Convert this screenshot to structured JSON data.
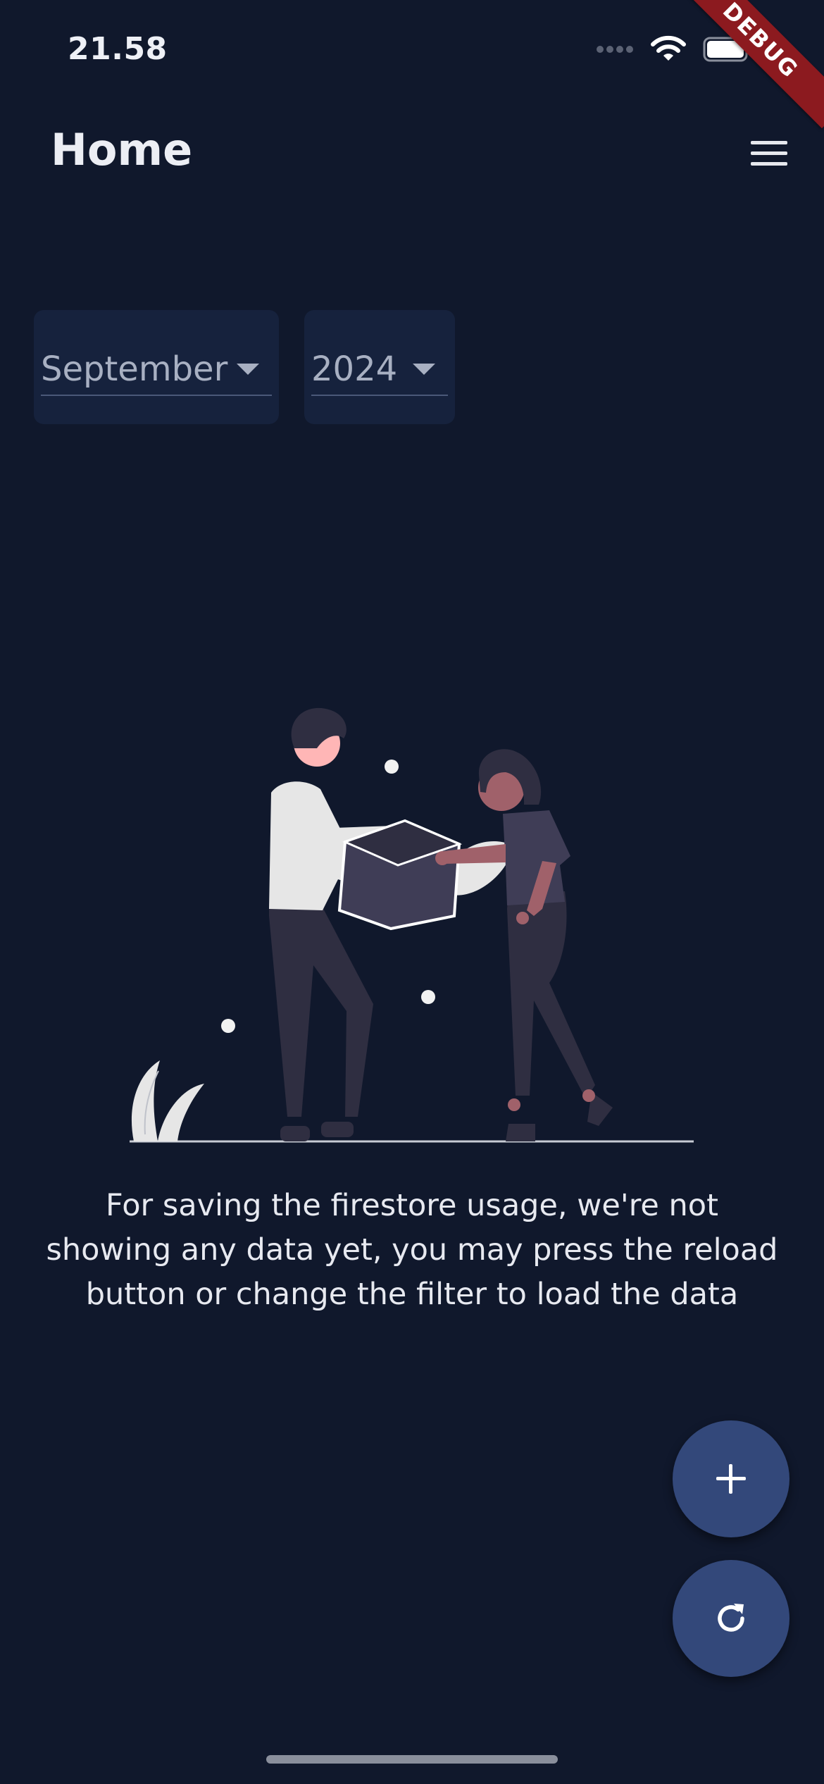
{
  "status_bar": {
    "time": "21.58",
    "icons": [
      "signal-dots-icon",
      "wifi-icon",
      "battery-icon"
    ]
  },
  "debug_banner": {
    "label": "DEBUG",
    "color": "#8c1a1f"
  },
  "header": {
    "title": "Home",
    "menu_icon": "hamburger-menu-icon"
  },
  "filters": {
    "month": {
      "selected": "September"
    },
    "year": {
      "selected": "2024"
    }
  },
  "empty_state": {
    "illustration": "two-people-exchanging-box-illustration",
    "message": "For saving the firestore usage, we're not showing any data yet, you may press the reload button or change the filter to load the data"
  },
  "fabs": [
    {
      "name": "add",
      "icon": "plus-icon"
    },
    {
      "name": "reload",
      "icon": "refresh-icon"
    }
  ],
  "colors": {
    "background": "#10182c",
    "surface": "#16223d",
    "fab": "#33487a",
    "text": "#eef0f6",
    "muted_text": "#a8b0c2"
  }
}
